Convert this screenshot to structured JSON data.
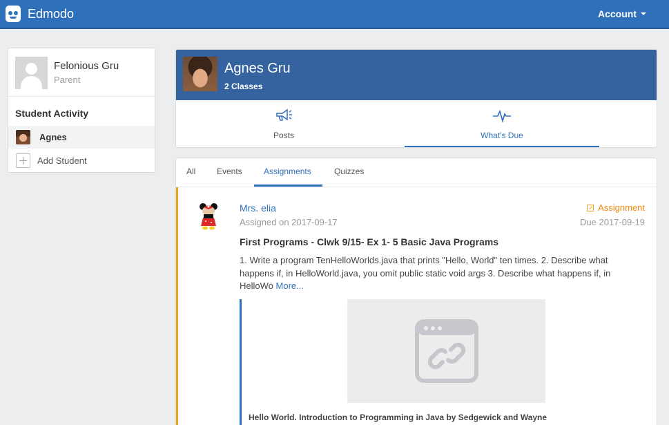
{
  "topbar": {
    "brand": "Edmodo",
    "account_label": "Account",
    "logo_icon": "edmodo-logo-icon",
    "colors": {
      "bar": "#2f70ba"
    }
  },
  "sidebar": {
    "profile_name": "Felonious Gru",
    "profile_role": "Parent",
    "section_title": "Student Activity",
    "students": [
      {
        "name": "Agnes"
      }
    ],
    "add_student_label": "Add Student"
  },
  "student": {
    "name": "Agnes Gru",
    "classes": "2 Classes",
    "tabs": [
      {
        "label": "Posts",
        "icon": "megaphone-icon"
      },
      {
        "label": "What's Due",
        "icon": "pulse-icon"
      }
    ]
  },
  "feed": {
    "filters": [
      "All",
      "Events",
      "Assignments",
      "Quizzes"
    ],
    "selected_filter": "Assignments",
    "post": {
      "teacher": "Mrs. elia",
      "assigned": "Assigned on 2017-09-17",
      "type": "Assignment",
      "due": "Due 2017-09-19",
      "title": "First Programs - Clwk 9/15- Ex 1- 5 Basic Java Programs",
      "body": "1. Write a program TenHelloWorlds.java that prints \"Hello, World\" ten times. 2. Describe what happens if, in HelloWorld.java, you omit public static void args 3. Describe what happens if, in HelloWo",
      "more": "More...",
      "link_caption": "Hello World. Introduction to Programming in Java by Sedgewick and Wayne",
      "accent": "#f0a21c"
    }
  }
}
